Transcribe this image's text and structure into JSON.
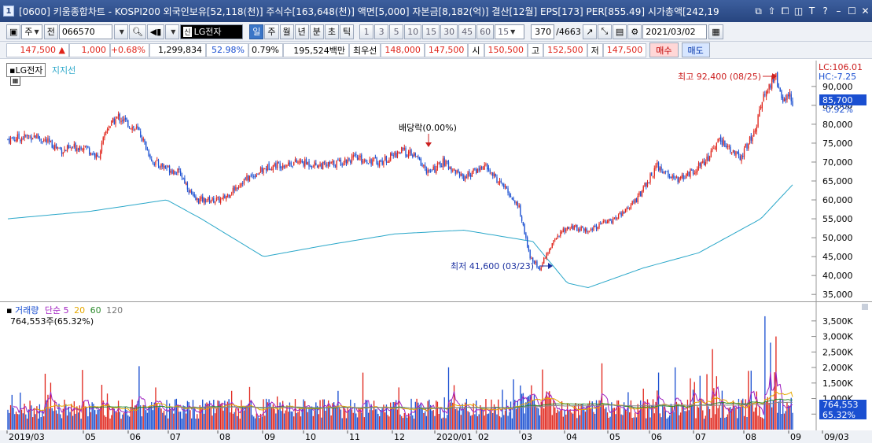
{
  "titlebar": {
    "window_number": "1",
    "title": "[0600] 키움종합차트 - KOSPI200 외국인보유[52,118(천)] 주식수[163,648(천)] 액면[5,000] 자본금[8,182(억)] 결산[12월] EPS[173] PER[855.49] 시가총액[242,19",
    "buttons": [
      "⧉",
      "⇧",
      "⧠",
      "◫",
      "T",
      "?",
      "–",
      "☐",
      "✕"
    ]
  },
  "toolbar1": {
    "period_select": "주",
    "prev_label": "전",
    "code": "066570",
    "stock_name": "LG전자",
    "new_badge": "신",
    "timeframes": [
      "일",
      "주",
      "월",
      "년",
      "분",
      "초",
      "틱"
    ],
    "active_timeframe": "일",
    "intervals": [
      "1",
      "3",
      "5",
      "10",
      "15",
      "30",
      "45",
      "60"
    ],
    "interval_value": "15",
    "count": "370",
    "total": "/4663",
    "date": "2021/03/02"
  },
  "quotebar": {
    "price": "147,500",
    "change": "1,000",
    "change_pct": "+0.68%",
    "volume": "1,299,834",
    "ratio1": "52.98%",
    "ratio2": "0.79%",
    "amount": "195,524백만",
    "pref_label": "최우선",
    "best_ask": "148,000",
    "best_bid": "147,500",
    "open_label": "시",
    "open": "150,500",
    "high_label": "고",
    "high": "152,500",
    "low_label": "저",
    "low": "147,500",
    "buy_label": "매수",
    "sell_label": "매도"
  },
  "price_panel": {
    "stock_label": "LG전자",
    "indicator_label": "지지선",
    "lc_label": "LC:106.01",
    "hc_label": "HC:-7.25",
    "current_price_tag": "85,700",
    "current_pct_tag": "-0.92%",
    "annotation_high": "최고 92,400 (08/25)",
    "annotation_low": "최저 41,600 (03/23)",
    "annotation_dividend": "배당락(0.00%)",
    "y_ticks": [
      "90,000",
      "85,000",
      "80,000",
      "75,000",
      "70,000",
      "65,000",
      "60,000",
      "55,000",
      "50,000",
      "45,000",
      "40,000",
      "35,000"
    ]
  },
  "vol_panel": {
    "title": "거래량",
    "ma_label": "단순",
    "ma_periods": [
      "5",
      "20",
      "60",
      "120"
    ],
    "info": "764,553주(65.32%)",
    "current_vol_tag": "764,553",
    "current_vol_pct": "65.32%",
    "y_ticks": [
      "3,500K",
      "3,000K",
      "2,500K",
      "2,000K",
      "1,500K",
      "1,000K",
      "500K"
    ]
  },
  "x_ticks": [
    "2019/03",
    "05",
    "06",
    "07",
    "08",
    "09",
    "10",
    "11",
    "12",
    "2020/01",
    "02",
    "03",
    "04",
    "05",
    "06",
    "07",
    "08",
    "09",
    "09/03"
  ],
  "colors": {
    "up": "#e0241a",
    "down": "#1a4fd1",
    "ma_line": "#2aa7c9",
    "vol_ma5": "#a020c0",
    "vol_ma20": "#e6a800",
    "vol_ma60": "#2e8b2e",
    "vol_ma120": "#888888"
  },
  "chart_data": {
    "type": "candlestick",
    "price_range": [
      34000,
      96000
    ],
    "volume_range": [
      0,
      3800000
    ],
    "price_keypoints": [
      [
        0,
        76000
      ],
      [
        20,
        77000
      ],
      [
        40,
        73000
      ],
      [
        55,
        74500
      ],
      [
        65,
        71000
      ],
      [
        72,
        79000
      ],
      [
        80,
        82000
      ],
      [
        95,
        78000
      ],
      [
        105,
        70000
      ],
      [
        125,
        67000
      ],
      [
        135,
        60000
      ],
      [
        155,
        60000
      ],
      [
        170,
        65000
      ],
      [
        190,
        69000
      ],
      [
        210,
        70000
      ],
      [
        230,
        69000
      ],
      [
        250,
        71000
      ],
      [
        270,
        70000
      ],
      [
        285,
        73000
      ],
      [
        295,
        71500
      ],
      [
        305,
        67000
      ],
      [
        315,
        70000
      ],
      [
        330,
        66000
      ],
      [
        345,
        69000
      ],
      [
        360,
        63000
      ],
      [
        370,
        58000
      ],
      [
        378,
        45000
      ],
      [
        385,
        42000
      ],
      [
        395,
        49000
      ],
      [
        405,
        53000
      ],
      [
        420,
        52000
      ],
      [
        440,
        55000
      ],
      [
        455,
        60000
      ],
      [
        470,
        69000
      ],
      [
        485,
        65000
      ],
      [
        505,
        70000
      ],
      [
        515,
        76000
      ],
      [
        530,
        71000
      ],
      [
        540,
        78000
      ],
      [
        548,
        88000
      ],
      [
        556,
        92400
      ],
      [
        560,
        86000
      ],
      [
        565,
        88000
      ],
      [
        568,
        85700
      ]
    ],
    "support_line": [
      [
        0,
        55000
      ],
      [
        60,
        57000
      ],
      [
        115,
        60000
      ],
      [
        140,
        55000
      ],
      [
        185,
        45000
      ],
      [
        230,
        48000
      ],
      [
        280,
        51000
      ],
      [
        330,
        52000
      ],
      [
        380,
        49000
      ],
      [
        405,
        38000
      ],
      [
        420,
        36800
      ],
      [
        460,
        42000
      ],
      [
        500,
        46000
      ],
      [
        545,
        55000
      ],
      [
        568,
        64000
      ]
    ]
  }
}
